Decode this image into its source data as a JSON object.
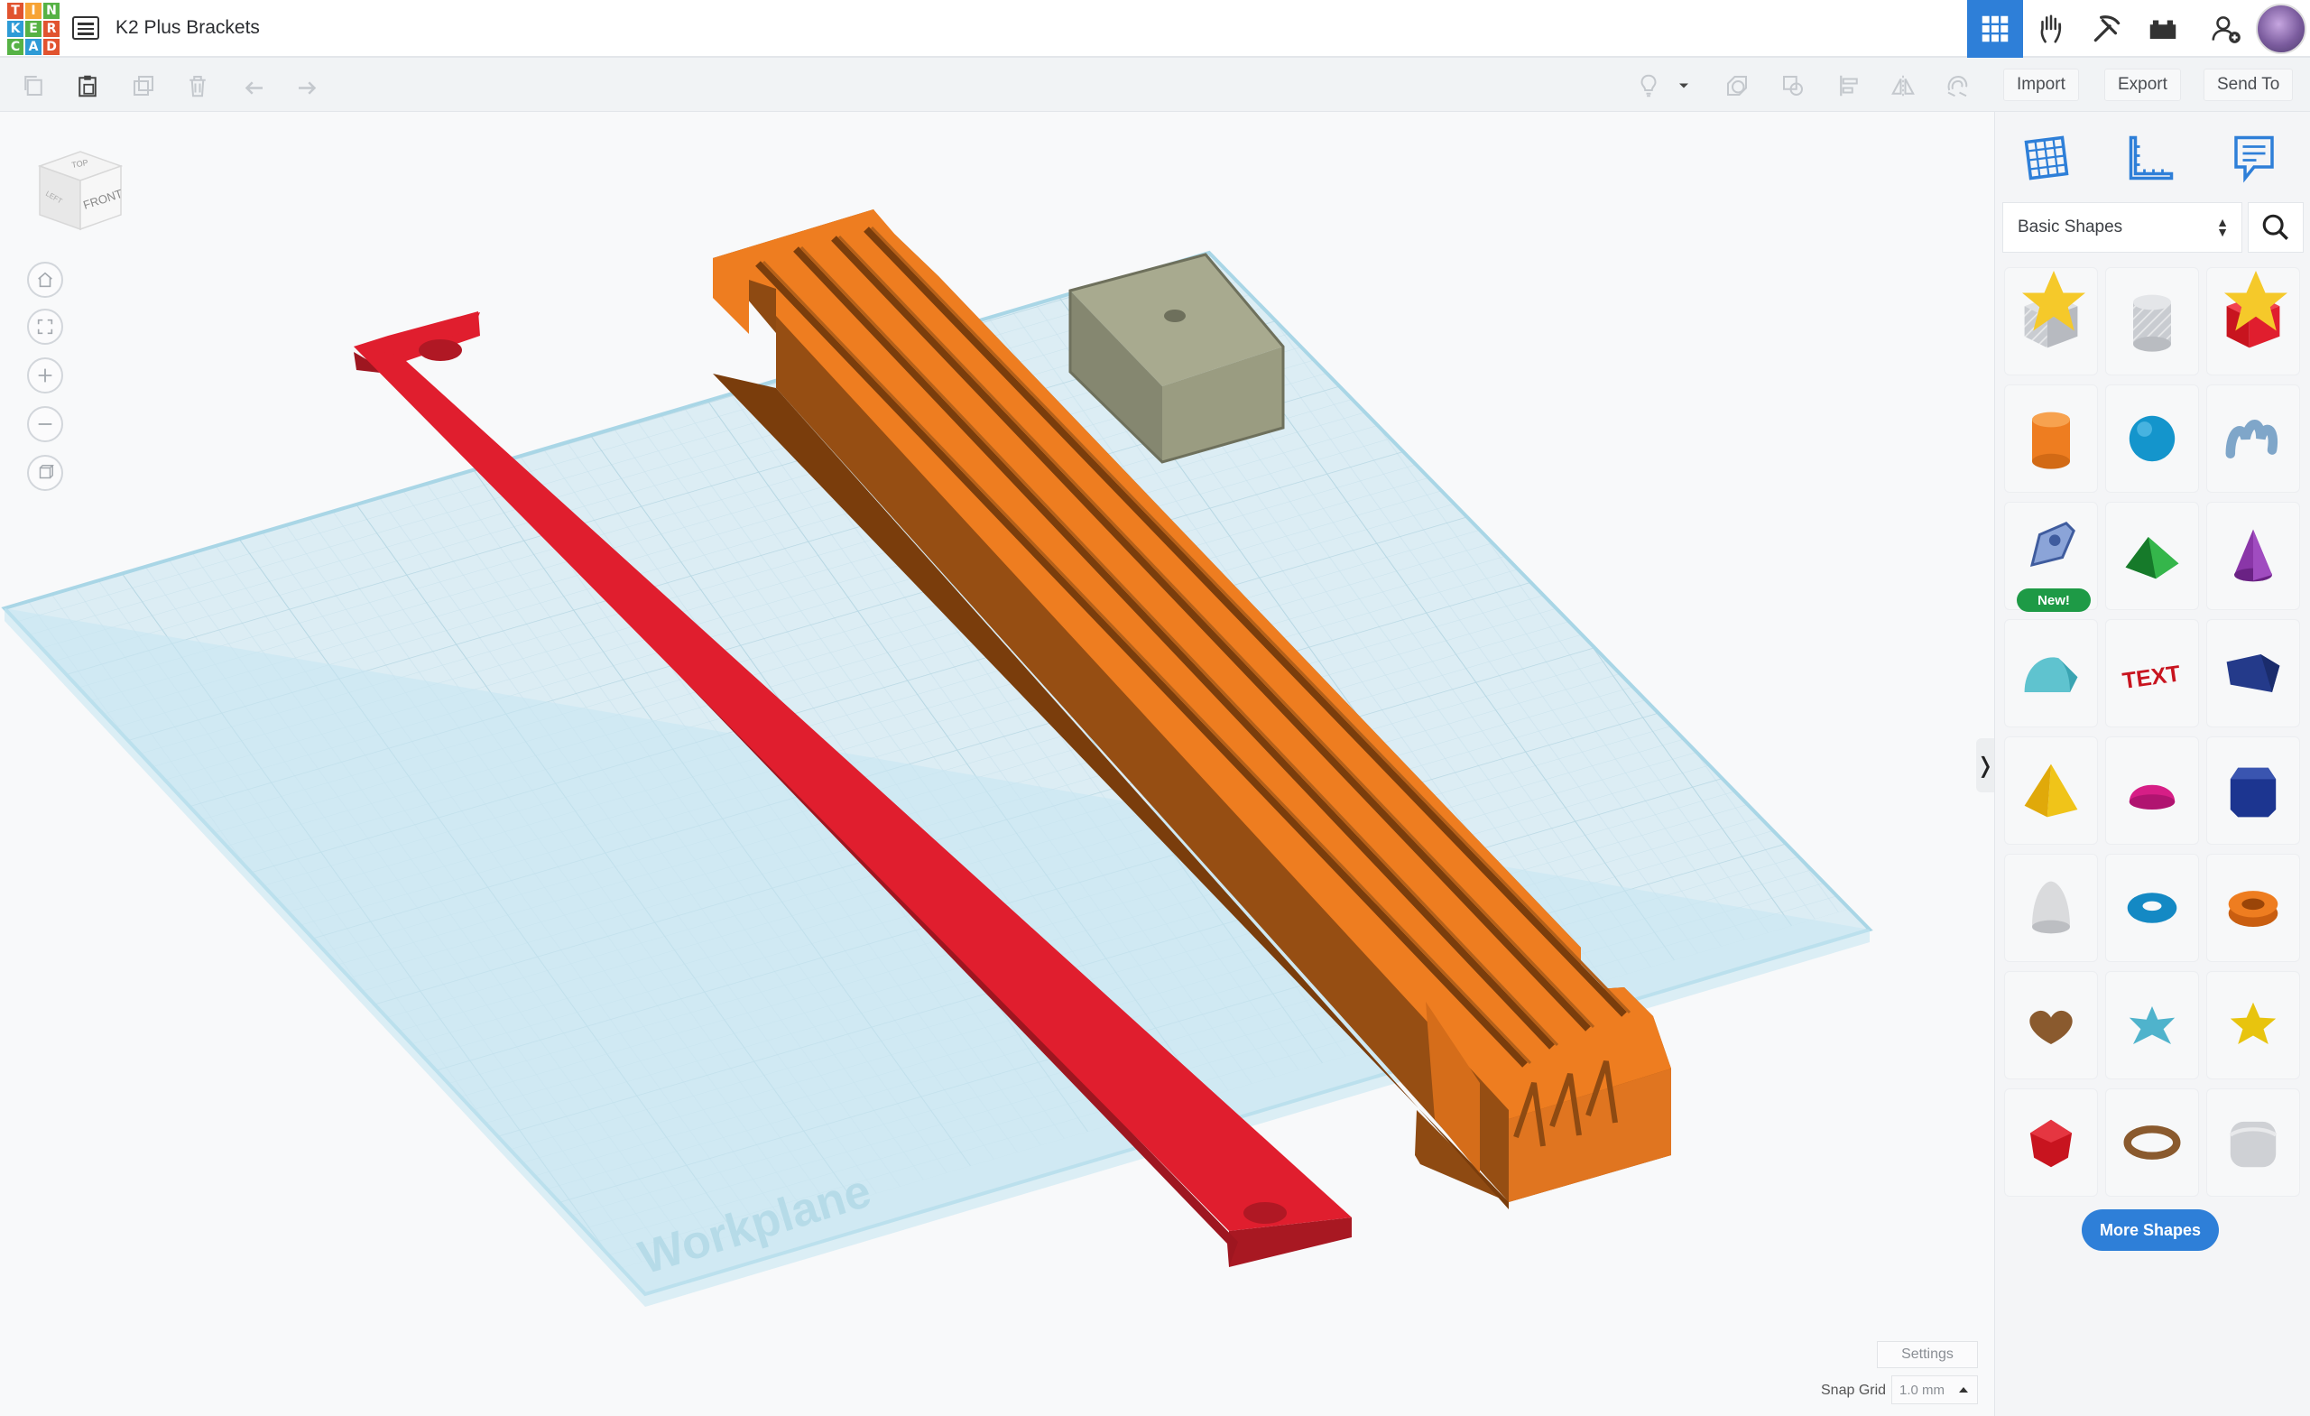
{
  "app": {
    "logo_letters": [
      "T",
      "I",
      "N",
      "K",
      "E",
      "R",
      "C",
      "A",
      "D"
    ],
    "logo_colors": [
      "#e1532f",
      "#f7a335",
      "#56b245",
      "#2e9bd6",
      "#56b245",
      "#e1532f",
      "#56b245",
      "#2e9bd6",
      "#e1532f"
    ],
    "design_title": "K2 Plus Brackets"
  },
  "topbar_icons": [
    {
      "name": "3d-view-grid-icon",
      "active": true
    },
    {
      "name": "codeblocks-hand-icon",
      "active": false
    },
    {
      "name": "minecraft-pickaxe-icon",
      "active": false
    },
    {
      "name": "bricks-icon",
      "active": false
    },
    {
      "name": "invite-user-icon",
      "active": false
    },
    {
      "name": "user-avatar",
      "active": false
    }
  ],
  "toolbar": {
    "import_label": "Import",
    "export_label": "Export",
    "send_to_label": "Send To"
  },
  "viewcube": {
    "top_label": "TOP",
    "front_label": "FRONT",
    "left_label": "LEFT"
  },
  "workplane": {
    "label": "Workplane"
  },
  "bottom": {
    "settings_label": "Settings",
    "snap_grid_label": "Snap Grid",
    "snap_grid_value": "1.0 mm"
  },
  "shapes_panel": {
    "library": "Basic Shapes",
    "new_badge": "New!",
    "text_shape_label": "TEXT",
    "more_shapes_label": "More Shapes",
    "shapes": [
      "box-hole",
      "cylinder-hole",
      "box",
      "cylinder",
      "sphere",
      "scribble",
      "shape-generator",
      "roof",
      "cone",
      "round-roof",
      "text",
      "wedge",
      "pyramid",
      "half-sphere",
      "polygon",
      "paraboloid",
      "torus",
      "tube",
      "heart",
      "star-six",
      "star",
      "icosahedron",
      "ring",
      "rounded-box"
    ]
  },
  "colors": {
    "accent": "#2e7fd8",
    "red_part": "#e01e2e",
    "orange_part": "#ee7d20",
    "gray_block": "#a8aa8f",
    "workplane": "#dff0f6",
    "new_badge": "#1e9a46"
  }
}
